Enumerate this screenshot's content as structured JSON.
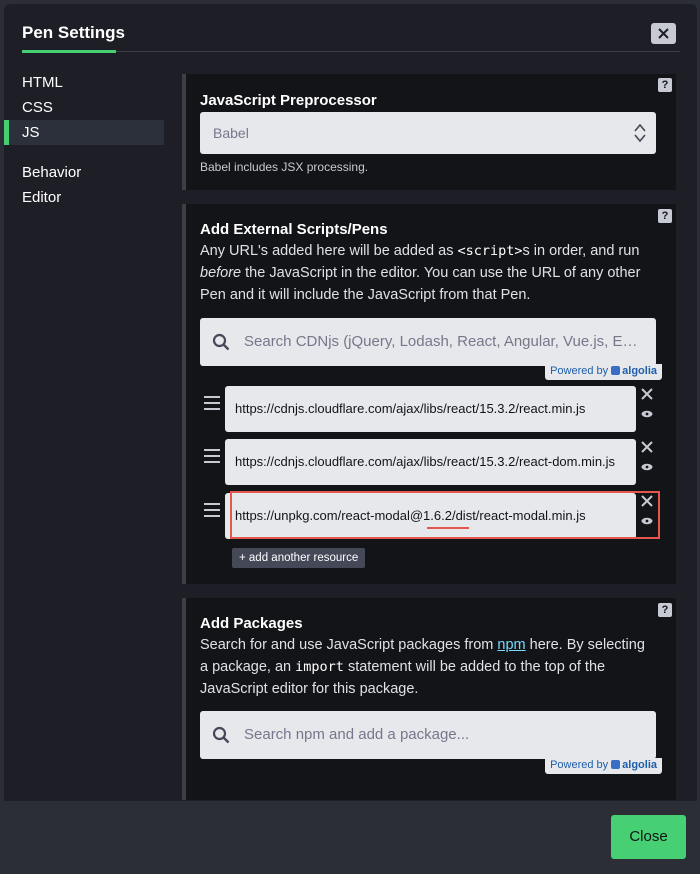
{
  "header": {
    "title": "Pen Settings"
  },
  "sidebar": {
    "items": [
      {
        "label": "HTML"
      },
      {
        "label": "CSS"
      },
      {
        "label": "JS",
        "active": true
      },
      {
        "label": "Behavior"
      },
      {
        "label": "Editor"
      }
    ]
  },
  "preprocessor": {
    "title": "JavaScript Preprocessor",
    "selected": "Babel",
    "hint": "Babel includes JSX processing.",
    "help": "?"
  },
  "external": {
    "title": "Add External Scripts/Pens",
    "help": "?",
    "desc_1": "Any URL's added here will be added as ",
    "desc_code": "<script>",
    "desc_2": "s in order, and run ",
    "desc_em": "before",
    "desc_3": " the JavaScript in the editor. You can use the URL of any other Pen and it will include the JavaScript from that Pen.",
    "search_placeholder": "Search CDNjs (jQuery, Lodash, React, Angular, Vue.js, Ember...",
    "powered_by": "Powered by",
    "powered_brand": "algolia",
    "resources": [
      "https://cdnjs.cloudflare.com/ajax/libs/react/15.3.2/react.min.js",
      "https://cdnjs.cloudflare.com/ajax/libs/react/15.3.2/react-dom.min.js",
      "https://unpkg.com/react-modal@1.6.2/dist/react-modal.min.js"
    ],
    "add_resource": "+ add another resource"
  },
  "packages": {
    "title": "Add Packages",
    "help": "?",
    "desc_1": "Search for and use JavaScript packages from ",
    "desc_link": "npm",
    "desc_2": " here. By selecting a package, an ",
    "desc_code": "import",
    "desc_3": " statement will be added to the top of the JavaScript editor for this package.",
    "search_placeholder": "Search npm and add a package...",
    "powered_by": "Powered by",
    "powered_brand": "algolia"
  },
  "footer": {
    "close_label": "Close"
  },
  "colors": {
    "accent": "#47cf73",
    "highlight": "#e5574e",
    "panel": "#131417"
  }
}
